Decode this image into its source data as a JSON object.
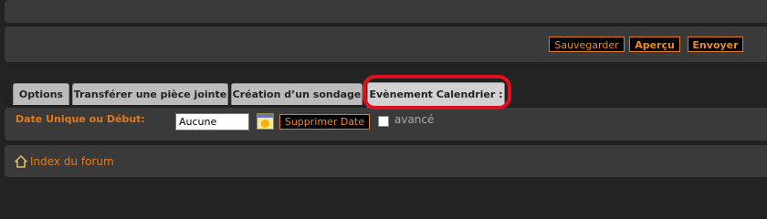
{
  "actions": {
    "save_label": "Sauvegarder",
    "preview_label": "Aperçu",
    "send_label": "Envoyer"
  },
  "tabs": [
    {
      "label": "Options"
    },
    {
      "label": "Transférer une pièce jointe"
    },
    {
      "label": "Création d’un sondage"
    },
    {
      "label": "Evènement Calendrier :",
      "active": true
    }
  ],
  "calendar_event": {
    "date_label": "Date Unique ou Début:",
    "date_value": "Aucune",
    "delete_date_label": "Supprimer Date",
    "advanced_label": "avancé"
  },
  "footer": {
    "forum_index_label": "Index du forum"
  },
  "colors": {
    "accent": "#e07a1f",
    "highlight_ring": "#e01020",
    "panel": "#3a3a3a",
    "background": "#222222"
  },
  "icons": {
    "calendar": "calendar-icon",
    "home": "home-icon"
  }
}
